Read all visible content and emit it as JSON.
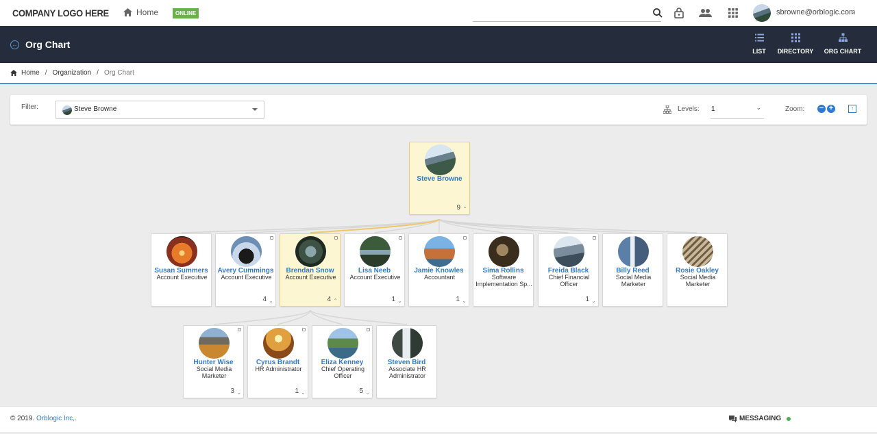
{
  "header": {
    "logo": "COMPANY LOGO HERE",
    "home_label": "Home",
    "status_badge": "ONLINE",
    "user_email": "sbrowne@orblogic.com",
    "icons": [
      "search-icon",
      "lock-icon",
      "people-icon",
      "apps-grid-icon"
    ]
  },
  "titlebar": {
    "title": "Org Chart",
    "views": [
      {
        "label": "LIST",
        "icon": "list-icon"
      },
      {
        "label": "DIRECTORY",
        "icon": "grid-icon"
      },
      {
        "label": "ORG CHART",
        "icon": "org-chart-icon"
      }
    ]
  },
  "breadcrumb": {
    "home": "Home",
    "separator": "/",
    "organization": "Organization",
    "current": "Org Chart"
  },
  "filter": {
    "label": "Filter:",
    "value": "Steve Browne",
    "levels_label": "Levels:",
    "levels_value": "1",
    "zoom_label": "Zoom:"
  },
  "org": {
    "root": {
      "name": "Steve Browne",
      "title": "",
      "count": "9"
    },
    "level1": [
      {
        "name": "Susan Summers",
        "title": "Account Executive",
        "count": ""
      },
      {
        "name": "Avery Cummings",
        "title": "Account Executive",
        "count": "4"
      },
      {
        "name": "Brendan Snow",
        "title": "Account Executive",
        "count": "4"
      },
      {
        "name": "Lisa Neeb",
        "title": "Account Executive",
        "count": "1"
      },
      {
        "name": "Jamie Knowles",
        "title": "Accountant",
        "count": "1"
      },
      {
        "name": "Sima Rollins",
        "title": "Software Implementation Sp...",
        "count": ""
      },
      {
        "name": "Freida Black",
        "title": "Chief Financial Officer",
        "count": "1"
      },
      {
        "name": "Billy Reed",
        "title": "Social Media Marketer",
        "count": ""
      },
      {
        "name": "Rosie Oakley",
        "title": "Social Media Marketer",
        "count": ""
      }
    ],
    "level2": [
      {
        "name": "Hunter Wise",
        "title": "Social Media Marketer",
        "count": "3"
      },
      {
        "name": "Cyrus Brandt",
        "title": "HR Administrator",
        "count": "1"
      },
      {
        "name": "Eliza Kenney",
        "title": "Chief Operating Officer",
        "count": "5"
      },
      {
        "name": "Steven Bird",
        "title": "Associate HR Administrator",
        "count": ""
      }
    ]
  },
  "footer": {
    "copyright_prefix": "© 2019.",
    "company_link": "Orblogic Inc,.",
    "messaging": "MESSAGING"
  }
}
